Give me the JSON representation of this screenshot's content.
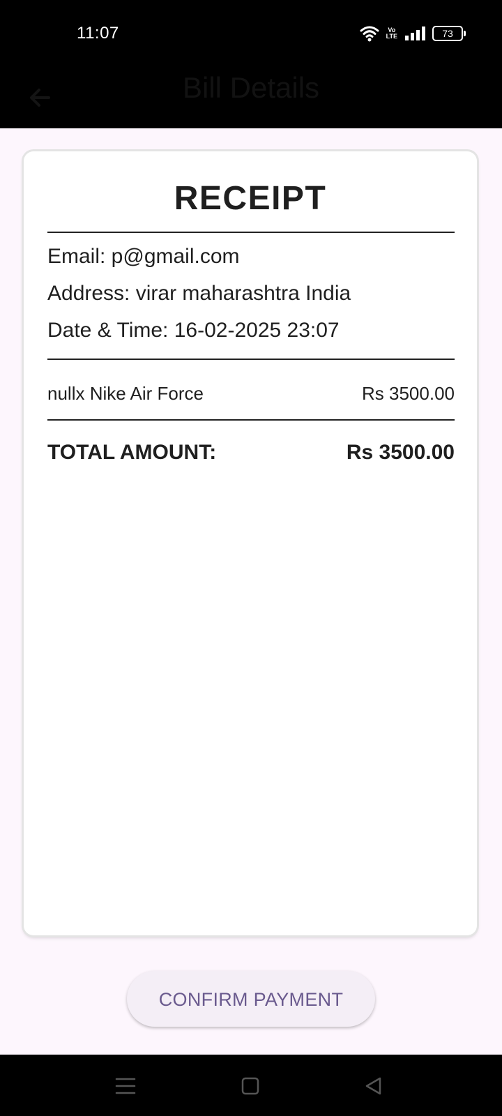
{
  "status_bar": {
    "time": "11:07",
    "volte_top": "Vo",
    "volte_bottom": "LTE",
    "battery_level": "73",
    "icons": [
      "wifi-icon",
      "volte-icon",
      "signal-icon",
      "battery-icon"
    ]
  },
  "app_bar": {
    "title": "Bill Details",
    "back_icon": "arrow-left-icon"
  },
  "receipt": {
    "title": "RECEIPT",
    "email": "Email: p@gmail.com",
    "address": "Address: virar maharashtra India",
    "datetime": "Date & Time: 16-02-2025 23:07",
    "items": [
      {
        "name": "nullx Nike Air Force",
        "price": "Rs 3500.00"
      }
    ],
    "total_label": "TOTAL AMOUNT:",
    "total_value": "Rs 3500.00"
  },
  "actions": {
    "confirm_label": "CONFIRM PAYMENT"
  },
  "nav_bar": {
    "icons": [
      "menu-icon",
      "home-icon",
      "back-triangle-icon"
    ]
  },
  "colors": {
    "background": "#fdf6fd",
    "card": "#ffffff",
    "button_text": "#6a5a8e",
    "button_bg": "#f4eef6"
  }
}
